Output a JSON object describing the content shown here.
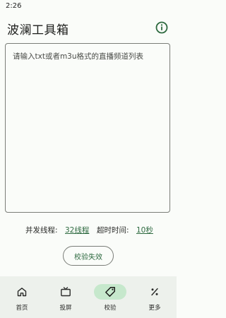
{
  "status_bar": {
    "time": "2:26"
  },
  "app_bar": {
    "title": "波澜工具箱",
    "info_icon": "info-icon"
  },
  "input": {
    "placeholder": "请输入txt或者m3u格式的直播频道列表",
    "value": ""
  },
  "settings": {
    "threads_label": "并发线程:",
    "threads_value": "32线程",
    "timeout_label": "超时时间:",
    "timeout_value": "10秒"
  },
  "verify_button": {
    "label": "校验失效"
  },
  "nav": {
    "items": [
      {
        "label": "首页",
        "icon": "home-icon",
        "active": false
      },
      {
        "label": "投屏",
        "icon": "tv-icon",
        "active": false
      },
      {
        "label": "校验",
        "icon": "tag-icon",
        "active": true
      },
      {
        "label": "更多",
        "icon": "percent-icon",
        "active": false
      }
    ]
  },
  "colors": {
    "accent": "#2e6a40",
    "active_pill": "#c6e8cc",
    "nav_background": "#edf1ec",
    "page_background": "#fafcf9"
  }
}
